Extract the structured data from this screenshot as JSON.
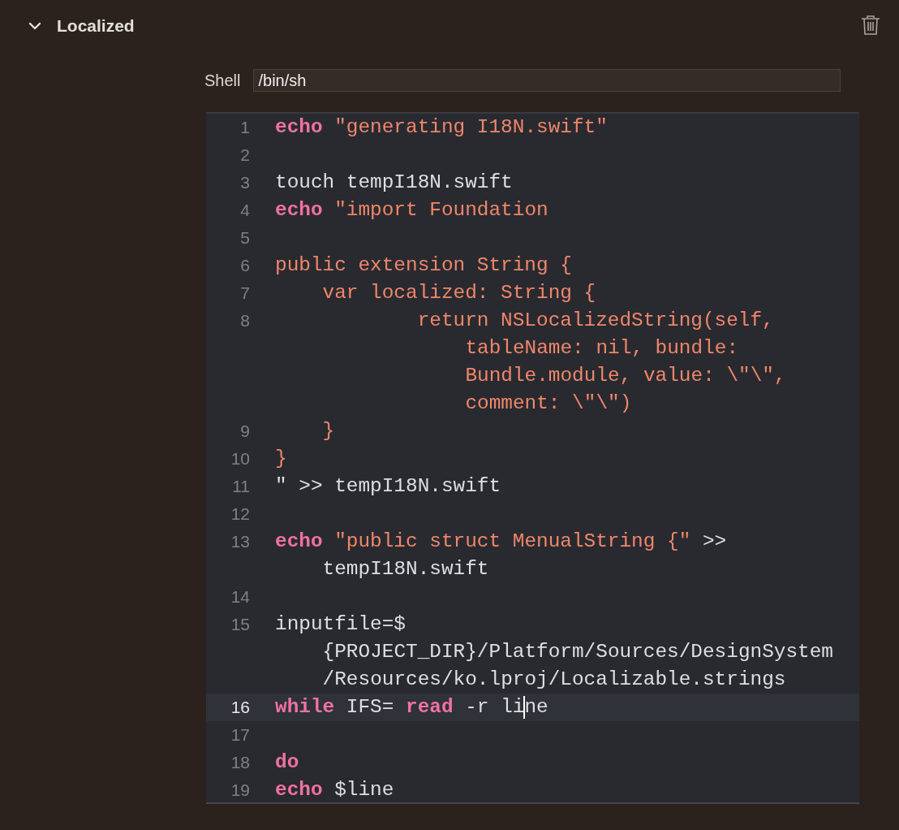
{
  "section": {
    "title": "Localized",
    "expanded": true
  },
  "shell": {
    "label": "Shell",
    "value": "/bin/sh"
  },
  "editor": {
    "lines": [
      {
        "number": "1",
        "current": false,
        "tokens": [
          {
            "kind": "keyword",
            "text": "echo "
          },
          {
            "kind": "string",
            "text": "\"generating I18N.swift\""
          }
        ]
      },
      {
        "number": "2",
        "current": false
      },
      {
        "number": "3",
        "current": false,
        "tokens": [
          {
            "kind": "plain",
            "text": "touch tempI18N.swift"
          }
        ]
      },
      {
        "number": "4",
        "current": false,
        "tokens": [
          {
            "kind": "keyword",
            "text": "echo "
          },
          {
            "kind": "string",
            "text": "\"import Foundation"
          }
        ]
      },
      {
        "number": "5",
        "current": false
      },
      {
        "number": "6",
        "current": false,
        "tokens": [
          {
            "kind": "string",
            "text": "public extension String {"
          }
        ]
      },
      {
        "number": "7",
        "current": false,
        "tokens": [
          {
            "kind": "string",
            "text": "    var localized: String {"
          }
        ]
      },
      {
        "number": "8",
        "current": false,
        "tokens": [
          {
            "kind": "string",
            "text": "            return NSLocalizedString(self,"
          }
        ],
        "wrap": {
          "kind": "string",
          "lines": [
            "tableName: nil, bundle:",
            "Bundle.module, value: \\\"\\\",",
            "comment: \\\"\\\")"
          ]
        }
      },
      {
        "number": "9",
        "current": false,
        "tokens": [
          {
            "kind": "string",
            "text": "    }"
          }
        ]
      },
      {
        "number": "10",
        "current": false,
        "tokens": [
          {
            "kind": "string",
            "text": "}"
          }
        ]
      },
      {
        "number": "11",
        "current": false,
        "tokens": [
          {
            "kind": "plain",
            "text": "\" >> tempI18N.swift"
          }
        ]
      },
      {
        "number": "12",
        "current": false
      },
      {
        "number": "13",
        "current": false,
        "tokens": [
          {
            "kind": "keyword",
            "text": "echo "
          },
          {
            "kind": "string",
            "text": "\"public struct MenualString {\""
          },
          {
            "kind": "plain",
            "text": " >>"
          }
        ],
        "wrap": {
          "kind": "plain",
          "lines": [
            "tempI18N.swift"
          ]
        }
      },
      {
        "number": "14",
        "current": false
      },
      {
        "number": "15",
        "current": false,
        "tokens": [
          {
            "kind": "plain",
            "text": "inputfile=$"
          }
        ],
        "wrap": {
          "kind": "plain",
          "lines": [
            "{PROJECT_DIR}/Platform/Sources/DesignSystem",
            "/Resources/ko.lproj/Localizable.strings"
          ]
        }
      },
      {
        "number": "16",
        "current": true,
        "tokens": [
          {
            "kind": "keyword",
            "text": "while"
          },
          {
            "kind": "plain",
            "text": " IFS= "
          },
          {
            "kind": "keyword",
            "text": "read"
          },
          {
            "kind": "plain",
            "text": " -r li"
          },
          {
            "kind": "cursor"
          },
          {
            "kind": "plain",
            "text": "ne"
          }
        ]
      },
      {
        "number": "17",
        "current": false
      },
      {
        "number": "18",
        "current": false,
        "tokens": [
          {
            "kind": "keyword",
            "text": "do"
          }
        ]
      },
      {
        "number": "19",
        "current": false,
        "tokens": [
          {
            "kind": "keyword",
            "text": "echo"
          },
          {
            "kind": "plain",
            "text": " $line"
          }
        ]
      }
    ]
  }
}
